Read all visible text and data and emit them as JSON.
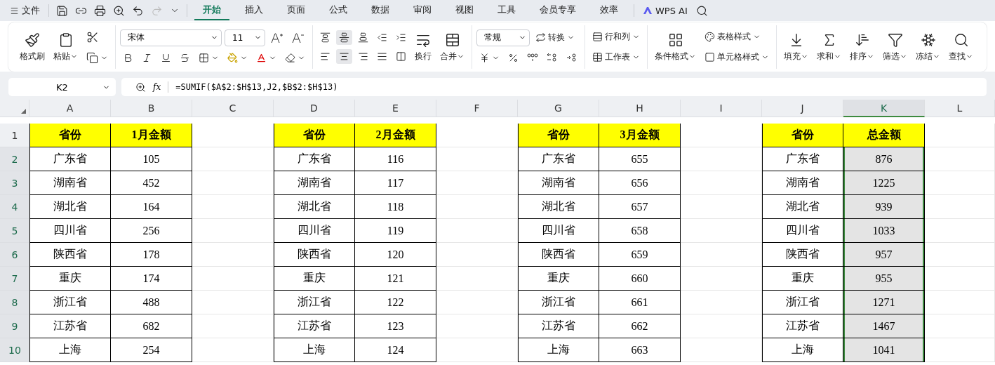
{
  "menu": {
    "file": "文件",
    "tabs": [
      {
        "label": "开始",
        "selected": true
      },
      {
        "label": "插入",
        "selected": false
      },
      {
        "label": "页面",
        "selected": false
      },
      {
        "label": "公式",
        "selected": false
      },
      {
        "label": "数据",
        "selected": false
      },
      {
        "label": "审阅",
        "selected": false
      },
      {
        "label": "视图",
        "selected": false
      },
      {
        "label": "工具",
        "selected": false
      },
      {
        "label": "会员专享",
        "selected": false
      },
      {
        "label": "效率",
        "selected": false
      }
    ],
    "ai": "WPS AI"
  },
  "ribbon": {
    "format_painter": "格式刷",
    "paste": "粘贴",
    "font_name": "宋体",
    "font_size": "11",
    "alignment": [
      {
        "pressed": false
      },
      {
        "pressed": true
      },
      {
        "pressed": false
      },
      {
        "pressed": false
      },
      {
        "pressed": false
      },
      {
        "pressed": false
      },
      {
        "pressed": true
      },
      {
        "pressed": false
      },
      {
        "pressed": false
      },
      {
        "pressed": false
      }
    ],
    "wrap": "换行",
    "merge": "合并",
    "number_format": "常规",
    "convert": "转换",
    "rows_cols": "行和列",
    "worksheet": "工作表",
    "conditional": "条件格式",
    "table_style": "表格样式",
    "cell_style": "单元格样式",
    "tools": [
      "填充",
      "求和",
      "排序",
      "筛选",
      "冻结",
      "查找"
    ]
  },
  "formula_bar": {
    "cell": "K2",
    "fx": "fx",
    "formula": "=SUMIF($A$2:$H$13,J2,$B$2:$H$13)"
  },
  "sheet": {
    "columns": [
      {
        "label": "A",
        "kind": "table",
        "selected": false
      },
      {
        "label": "B",
        "kind": "table",
        "selected": false
      },
      {
        "label": "C",
        "kind": "gap",
        "selected": false
      },
      {
        "label": "D",
        "kind": "table",
        "selected": false
      },
      {
        "label": "E",
        "kind": "table",
        "selected": false
      },
      {
        "label": "F",
        "kind": "gap",
        "selected": false
      },
      {
        "label": "G",
        "kind": "table",
        "selected": false
      },
      {
        "label": "H",
        "kind": "table",
        "selected": false
      },
      {
        "label": "I",
        "kind": "gap",
        "selected": false
      },
      {
        "label": "J",
        "kind": "table",
        "selected": false
      },
      {
        "label": "K",
        "kind": "table",
        "selected": true
      },
      {
        "label": "L",
        "kind": "gap",
        "selected": false
      }
    ],
    "rows": [
      {
        "number": "1",
        "kind": "header",
        "selected": false,
        "cells": [
          "省份",
          "1月金额",
          null,
          "省份",
          "2月金额",
          null,
          "省份",
          "3月金额",
          null,
          "省份",
          "总金额",
          null
        ]
      },
      {
        "number": "2",
        "kind": "data",
        "selected": true,
        "cells": [
          "广东省",
          "105",
          null,
          "广东省",
          "116",
          null,
          "广东省",
          "655",
          null,
          "广东省",
          "876",
          null
        ]
      },
      {
        "number": "3",
        "kind": "data",
        "selected": true,
        "cells": [
          "湖南省",
          "452",
          null,
          "湖南省",
          "117",
          null,
          "湖南省",
          "656",
          null,
          "湖南省",
          "1225",
          null
        ]
      },
      {
        "number": "4",
        "kind": "data",
        "selected": true,
        "cells": [
          "湖北省",
          "164",
          null,
          "湖北省",
          "118",
          null,
          "湖北省",
          "657",
          null,
          "湖北省",
          "939",
          null
        ]
      },
      {
        "number": "5",
        "kind": "data",
        "selected": true,
        "cells": [
          "四川省",
          "256",
          null,
          "四川省",
          "119",
          null,
          "四川省",
          "658",
          null,
          "四川省",
          "1033",
          null
        ]
      },
      {
        "number": "6",
        "kind": "data",
        "selected": true,
        "cells": [
          "陕西省",
          "178",
          null,
          "陕西省",
          "120",
          null,
          "陕西省",
          "659",
          null,
          "陕西省",
          "957",
          null
        ]
      },
      {
        "number": "7",
        "kind": "data",
        "selected": true,
        "cells": [
          "重庆",
          "174",
          null,
          "重庆",
          "121",
          null,
          "重庆",
          "660",
          null,
          "重庆",
          "955",
          null
        ]
      },
      {
        "number": "8",
        "kind": "data",
        "selected": true,
        "cells": [
          "浙江省",
          "488",
          null,
          "浙江省",
          "122",
          null,
          "浙江省",
          "661",
          null,
          "浙江省",
          "1271",
          null
        ]
      },
      {
        "number": "9",
        "kind": "data",
        "selected": true,
        "cells": [
          "江苏省",
          "682",
          null,
          "江苏省",
          "123",
          null,
          "江苏省",
          "662",
          null,
          "江苏省",
          "1467",
          null
        ]
      },
      {
        "number": "10",
        "kind": "data",
        "selected": true,
        "cells": [
          "上海",
          "254",
          null,
          "上海",
          "124",
          null,
          "上海",
          "663",
          null,
          "上海",
          "1041",
          null
        ]
      }
    ]
  }
}
